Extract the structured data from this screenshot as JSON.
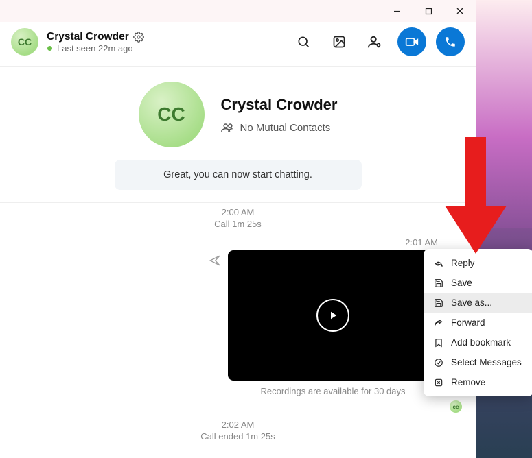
{
  "header": {
    "avatar_initials": "CC",
    "name": "Crystal Crowder",
    "presence": "Last seen 22m ago"
  },
  "profile": {
    "avatar_initials": "CC",
    "name": "Crystal Crowder",
    "mutual": "No Mutual Contacts"
  },
  "banner": {
    "start_chat": "Great, you can now start chatting."
  },
  "timeline": {
    "t1": "2:00 AM",
    "call1_dur": "Call 1m 25s",
    "t2": "2:01 AM",
    "recording_note": "Recordings are available for 30 days",
    "seen_initials": "cc",
    "t3": "2:02 AM",
    "call2_dur": "Call ended 1m 25s"
  },
  "context_menu": {
    "reply": "Reply",
    "save": "Save",
    "save_as": "Save as...",
    "forward": "Forward",
    "bookmark": "Add bookmark",
    "select": "Select Messages",
    "remove": "Remove"
  }
}
